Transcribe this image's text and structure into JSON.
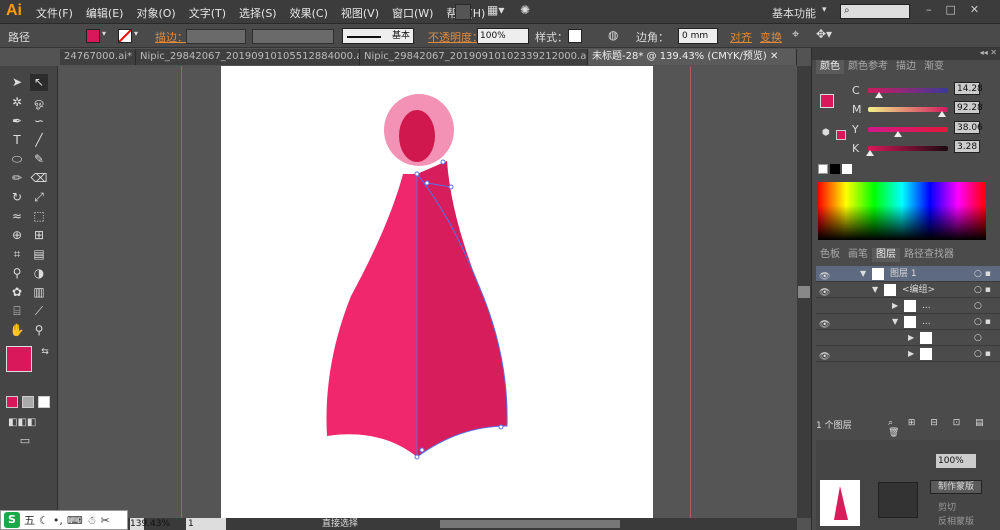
{
  "app": {
    "logo": "Ai",
    "workspace": "基本功能",
    "search_placeholder": ""
  },
  "menu": [
    "文件(F)",
    "编辑(E)",
    "对象(O)",
    "文字(T)",
    "选择(S)",
    "效果(C)",
    "视图(V)",
    "窗口(W)",
    "帮助(H)"
  ],
  "control": {
    "path_label": "路径",
    "stroke_label": "描边：",
    "stroke_style": "基本",
    "opacity_label": "不透明度：",
    "opacity_value": "100%",
    "style_label": "样式：",
    "corner_label": "边角：",
    "corner_value": "0 mm",
    "align_label": "对齐",
    "transform_label": "变换"
  },
  "tabs": [
    "24767000.ai*",
    "Nipic_29842067_20190910105512884000.ai*",
    "Nipic_29842067_20190910102339212000.ai*",
    "未标题-28* @ 139.43% (CMYK/预览)"
  ],
  "colors": {
    "fill": "#d8185a",
    "dress_light": "#f0276d",
    "dress_dark": "#d71d5c",
    "collar": "#f392b4",
    "collar_inner": "#d0184f",
    "path": "#5a6fe0"
  },
  "color_panel": {
    "tabs": [
      "颜色",
      "颜色参考",
      "描边",
      "渐变"
    ],
    "c": {
      "label": "C",
      "value": "14.28",
      "level": 0.14
    },
    "m": {
      "label": "M",
      "value": "92.28",
      "level": 0.92
    },
    "y": {
      "label": "Y",
      "value": "38.06",
      "level": 0.38
    },
    "k": {
      "label": "K",
      "value": "3.28",
      "level": 0.03
    }
  },
  "layers_panel": {
    "tabs": [
      "色板",
      "画笔",
      "图层",
      "路径查找器"
    ],
    "rows": [
      "图层 1",
      "<编组>",
      "...",
      "...",
      "",
      ""
    ],
    "footer": "1 个图层"
  },
  "lower_panel": {
    "zoom": "100%",
    "mask_button": "制作蒙版",
    "clip_label": "剪切",
    "invert_label": "反相蒙版"
  },
  "status": {
    "zoom": "139.43%",
    "page": "1",
    "tool": "直接选择"
  },
  "ime": {
    "logo": "S",
    "label": "五"
  }
}
